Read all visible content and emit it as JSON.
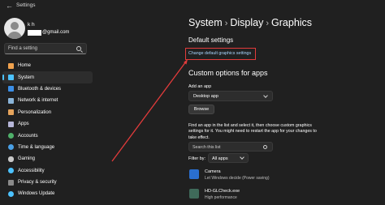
{
  "window": {
    "title": "Settings",
    "back_glyph": "←"
  },
  "user": {
    "name": "k h",
    "email_suffix": "@gmail.com"
  },
  "search": {
    "placeholder": "Find a setting"
  },
  "sidebar": {
    "items": [
      {
        "label": "Home",
        "icon": "home-icon",
        "color": "#f0a24e"
      },
      {
        "label": "System",
        "icon": "system-icon",
        "color": "#4cc2ff"
      },
      {
        "label": "Bluetooth & devices",
        "icon": "bluetooth-icon",
        "color": "#3b8ee6"
      },
      {
        "label": "Network & internet",
        "icon": "network-icon",
        "color": "#8ab4d8"
      },
      {
        "label": "Personalization",
        "icon": "brush-icon",
        "color": "#e6a45c"
      },
      {
        "label": "Apps",
        "icon": "apps-icon",
        "color": "#b6b6d8"
      },
      {
        "label": "Accounts",
        "icon": "accounts-icon",
        "color": "#4fb06a"
      },
      {
        "label": "Time & language",
        "icon": "globe-clock-icon",
        "color": "#4aa0e6"
      },
      {
        "label": "Gaming",
        "icon": "gaming-icon",
        "color": "#c8c8c8"
      },
      {
        "label": "Accessibility",
        "icon": "accessibility-icon",
        "color": "#4cc2ff"
      },
      {
        "label": "Privacy & security",
        "icon": "shield-icon",
        "color": "#8a8a8a"
      },
      {
        "label": "Windows Update",
        "icon": "update-icon",
        "color": "#4cc2ff"
      }
    ],
    "active_index": 1
  },
  "breadcrumb": {
    "parts": [
      "System",
      "Display",
      "Graphics"
    ],
    "separator": "›"
  },
  "default_settings": {
    "title": "Default settings",
    "link_label": "Change default graphics settings"
  },
  "custom_options": {
    "title": "Custom options for apps",
    "add_label": "Add an app",
    "app_type": "Desktop app",
    "browse_label": "Browse",
    "help_lines": [
      "Find an app in the list and select it, then choose custom graphics",
      "settings for it. You might need to restart the app for your changes to",
      "take effect."
    ],
    "list_search_placeholder": "Search this list",
    "filter_label": "Filter by:",
    "filter_value": "All apps"
  },
  "apps": [
    {
      "name": "Camera",
      "status": "Let Windows decide (Power saving)",
      "icon": "camera-app-icon",
      "color": "#2a6fd1"
    },
    {
      "name": "HD-GLCheck.exe",
      "status": "High performance",
      "icon": "exe-app-icon",
      "color": "#3f6a5a"
    }
  ],
  "colors": {
    "background": "#202020",
    "accent": "#4cc2ff",
    "highlight_box": "#e23b3b",
    "link": "#a9d7ff"
  }
}
